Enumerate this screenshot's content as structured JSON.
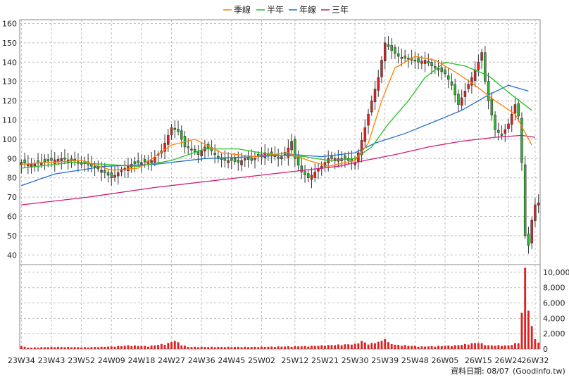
{
  "chart_data": {
    "type": "candlestick",
    "legend": [
      {
        "name": "季線",
        "color": "#ff8000"
      },
      {
        "name": "半年",
        "color": "#22c222"
      },
      {
        "name": "年線",
        "color": "#1f6fd0"
      },
      {
        "name": "三年",
        "color": "#d21a78"
      }
    ],
    "price_axis": {
      "ticks": [
        40,
        50,
        60,
        70,
        80,
        90,
        100,
        110,
        120,
        130,
        140,
        150,
        160
      ],
      "ylim": [
        35,
        162
      ]
    },
    "volume_axis": {
      "ticks": [
        "0",
        "2,000",
        "4,000",
        "6,000",
        "8,000",
        "10,000"
      ],
      "tick_values": [
        0,
        2000,
        4000,
        6000,
        8000,
        10000
      ],
      "ylim": [
        0,
        11000
      ]
    },
    "x_labels": [
      "23W34",
      "23W43",
      "23W52",
      "24W09",
      "24W18",
      "24W27",
      "24W36",
      "24W45",
      "25W02",
      "25W12",
      "25W21",
      "25W30",
      "25W39",
      "25W48",
      "26W05",
      "26W15",
      "26W24",
      "26W32"
    ],
    "x_label_weeks": [
      0,
      9,
      18,
      27,
      36,
      45,
      54,
      63,
      72,
      82,
      91,
      100,
      109,
      118,
      127,
      137,
      146,
      154
    ],
    "weeks": 156,
    "close_anchors": [
      [
        0,
        88
      ],
      [
        3,
        87
      ],
      [
        6,
        88
      ],
      [
        9,
        89
      ],
      [
        12,
        90
      ],
      [
        15,
        89
      ],
      [
        18,
        88
      ],
      [
        21,
        86
      ],
      [
        24,
        84
      ],
      [
        27,
        80
      ],
      [
        30,
        84
      ],
      [
        33,
        87
      ],
      [
        36,
        88
      ],
      [
        39,
        89
      ],
      [
        42,
        94
      ],
      [
        45,
        106
      ],
      [
        47,
        104
      ],
      [
        49,
        96
      ],
      [
        51,
        95
      ],
      [
        53,
        92
      ],
      [
        55,
        96
      ],
      [
        57,
        94
      ],
      [
        59,
        90
      ],
      [
        61,
        89
      ],
      [
        63,
        89
      ],
      [
        65,
        88
      ],
      [
        67,
        90
      ],
      [
        69,
        89
      ],
      [
        71,
        91
      ],
      [
        73,
        93
      ],
      [
        75,
        92
      ],
      [
        77,
        90
      ],
      [
        79,
        92
      ],
      [
        81,
        99
      ],
      [
        82,
        90
      ],
      [
        84,
        83
      ],
      [
        86,
        80
      ],
      [
        88,
        83
      ],
      [
        90,
        86
      ],
      [
        92,
        90
      ],
      [
        94,
        90
      ],
      [
        96,
        90
      ],
      [
        98,
        89
      ],
      [
        100,
        88
      ],
      [
        101,
        93
      ],
      [
        103,
        106
      ],
      [
        105,
        120
      ],
      [
        107,
        132
      ],
      [
        109,
        150
      ],
      [
        111,
        146
      ],
      [
        113,
        143
      ],
      [
        115,
        142
      ],
      [
        117,
        141
      ],
      [
        119,
        140
      ],
      [
        121,
        141
      ],
      [
        123,
        138
      ],
      [
        125,
        136
      ],
      [
        127,
        134
      ],
      [
        129,
        128
      ],
      [
        131,
        118
      ],
      [
        133,
        125
      ],
      [
        135,
        132
      ],
      [
        137,
        140
      ],
      [
        138,
        145
      ],
      [
        139,
        130
      ],
      [
        140,
        120
      ],
      [
        142,
        105
      ],
      [
        144,
        102
      ],
      [
        146,
        108
      ],
      [
        148,
        118
      ],
      [
        149,
        112
      ],
      [
        150,
        88
      ],
      [
        151,
        50
      ],
      [
        152,
        45
      ],
      [
        153,
        58
      ],
      [
        154,
        66
      ],
      [
        155,
        67
      ]
    ],
    "volume_anchors": [
      [
        0,
        500
      ],
      [
        1,
        300
      ],
      [
        2,
        200
      ],
      [
        10,
        300
      ],
      [
        20,
        250
      ],
      [
        27,
        350
      ],
      [
        32,
        500
      ],
      [
        38,
        400
      ],
      [
        44,
        800
      ],
      [
        46,
        1200
      ],
      [
        47,
        900
      ],
      [
        48,
        600
      ],
      [
        50,
        300
      ],
      [
        70,
        300
      ],
      [
        85,
        400
      ],
      [
        100,
        700
      ],
      [
        102,
        1100
      ],
      [
        104,
        700
      ],
      [
        106,
        900
      ],
      [
        108,
        1100
      ],
      [
        109,
        1600
      ],
      [
        110,
        900
      ],
      [
        112,
        600
      ],
      [
        120,
        350
      ],
      [
        130,
        500
      ],
      [
        137,
        900
      ],
      [
        140,
        500
      ],
      [
        146,
        500
      ],
      [
        149,
        900
      ],
      [
        150,
        5000
      ],
      [
        151,
        11000
      ],
      [
        152,
        6200
      ],
      [
        153,
        3000
      ],
      [
        154,
        1500
      ],
      [
        155,
        900
      ]
    ],
    "ma_lines": {
      "year": [
        [
          0,
          76
        ],
        [
          10,
          82
        ],
        [
          25,
          86
        ],
        [
          40,
          87
        ],
        [
          55,
          90
        ],
        [
          70,
          91
        ],
        [
          82,
          92
        ],
        [
          90,
          91
        ],
        [
          100,
          93
        ],
        [
          106,
          98
        ],
        [
          115,
          103
        ],
        [
          125,
          110
        ],
        [
          132,
          115
        ],
        [
          140,
          123
        ],
        [
          146,
          128
        ],
        [
          152,
          125
        ]
      ],
      "three_year": [
        [
          0,
          66
        ],
        [
          20,
          70
        ],
        [
          40,
          75
        ],
        [
          60,
          79
        ],
        [
          80,
          83
        ],
        [
          95,
          86
        ],
        [
          103,
          89
        ],
        [
          112,
          92
        ],
        [
          122,
          96
        ],
        [
          132,
          99
        ],
        [
          142,
          101
        ],
        [
          150,
          102
        ],
        [
          154,
          101
        ]
      ],
      "half_year": [
        [
          0,
          85
        ],
        [
          15,
          88
        ],
        [
          25,
          87
        ],
        [
          35,
          86
        ],
        [
          45,
          89
        ],
        [
          55,
          95
        ],
        [
          65,
          95
        ],
        [
          75,
          92
        ],
        [
          85,
          91
        ],
        [
          92,
          89
        ],
        [
          100,
          90
        ],
        [
          105,
          96
        ],
        [
          110,
          108
        ],
        [
          116,
          120
        ],
        [
          121,
          132
        ],
        [
          127,
          140
        ],
        [
          133,
          138
        ],
        [
          140,
          133
        ],
        [
          147,
          123
        ],
        [
          153,
          115
        ]
      ],
      "quarter": [
        [
          0,
          87
        ],
        [
          8,
          88
        ],
        [
          18,
          89
        ],
        [
          27,
          84
        ],
        [
          35,
          85
        ],
        [
          45,
          97
        ],
        [
          52,
          100
        ],
        [
          60,
          93
        ],
        [
          70,
          91
        ],
        [
          80,
          93
        ],
        [
          86,
          89
        ],
        [
          92,
          86
        ],
        [
          100,
          89
        ],
        [
          104,
          98
        ],
        [
          108,
          120
        ],
        [
          112,
          137
        ],
        [
          118,
          143
        ],
        [
          124,
          141
        ],
        [
          130,
          135
        ],
        [
          136,
          128
        ],
        [
          142,
          120
        ],
        [
          148,
          113
        ],
        [
          153,
          97
        ]
      ]
    },
    "grid": true
  },
  "footer": {
    "data_date": "資料日期: 08/07",
    "source": "(Goodinfo.tw)"
  }
}
